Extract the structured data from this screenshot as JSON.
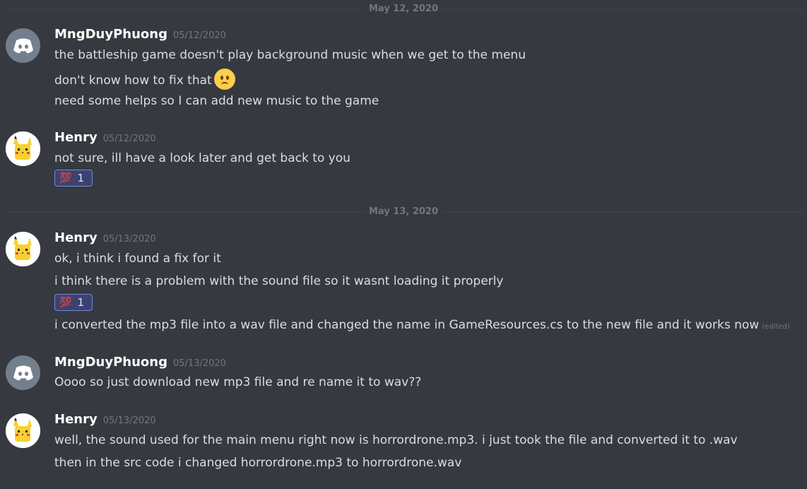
{
  "dividers": [
    "May 12, 2020",
    "May 13, 2020"
  ],
  "groups": [
    {
      "user": "MngDuyPhuong",
      "time": "05/12/2020",
      "avatar": "discord-logo-icon",
      "lines": [
        "the battleship game doesn't play background music when we get to the menu",
        "don't know how to fix that",
        "need some helps so I can add new music to the game"
      ],
      "inline_emoji": "frowning-face-icon"
    },
    {
      "user": "Henry",
      "time": "05/12/2020",
      "avatar": "pikachu-avatar-icon",
      "lines": [
        "not sure, ill have a look later and get back to you"
      ],
      "reaction": {
        "emoji": "💯",
        "count": "1"
      }
    },
    {
      "user": "Henry",
      "time": "05/13/2020",
      "avatar": "pikachu-avatar-icon",
      "lines": [
        "ok, i think i found a fix for it",
        "i think there is a problem with the sound file so it wasnt loading it properly",
        "i converted the mp3 file into a wav file and changed the name in GameResources.cs to the new file and it works now"
      ],
      "edited_label": "(edited)",
      "reaction": {
        "emoji": "💯",
        "count": "1"
      }
    },
    {
      "user": "MngDuyPhuong",
      "time": "05/13/2020",
      "avatar": "discord-logo-icon",
      "lines": [
        "Oooo so just download new mp3 file and re name it to wav??"
      ]
    },
    {
      "user": "Henry",
      "time": "05/13/2020",
      "avatar": "pikachu-avatar-icon",
      "lines": [
        "well, the sound used for the main menu right now is horrordrone.mp3. i just took the file and converted it to .wav",
        "then in the src code i changed horrordrone.mp3 to horrordrone.wav"
      ]
    }
  ],
  "colors": {
    "background": "#36393f",
    "username": "#ffffff",
    "text": "#dcddde",
    "muted": "#72767d",
    "reaction_bg": "#3c4270",
    "reaction_border": "#7289da"
  }
}
